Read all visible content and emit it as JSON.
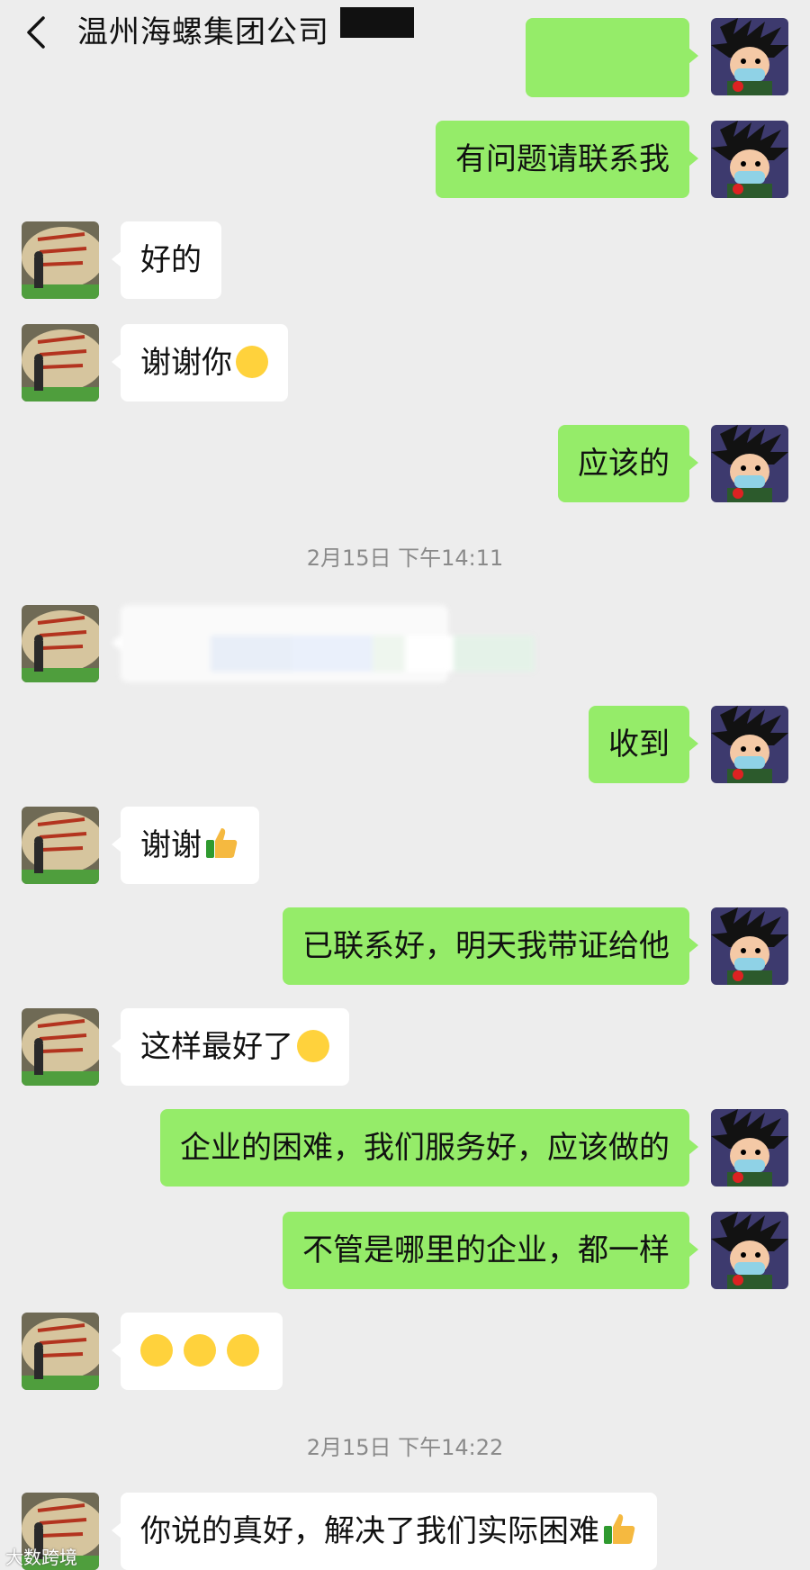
{
  "header": {
    "title": "温州海螺集团公司",
    "back_icon": "chevron-left-icon",
    "more_icon": "more-dots-icon",
    "more_label": "···"
  },
  "colors": {
    "background": "#ededed",
    "mine_bubble": "#95ec69",
    "theirs_bubble": "#ffffff",
    "timestamp": "#8a8a8a"
  },
  "messages": [
    {
      "from": "me",
      "text": "有问题请联系我"
    },
    {
      "from": "them",
      "text": "好的"
    },
    {
      "from": "them",
      "text": "谢谢你",
      "emoji": "smile"
    },
    {
      "from": "me",
      "text": "应该的"
    },
    {
      "type": "time",
      "text": "2月15日 下午14:11"
    },
    {
      "from": "them",
      "text": "",
      "blurred": true
    },
    {
      "from": "me",
      "text": "收到"
    },
    {
      "from": "them",
      "text": "谢谢",
      "emoji": "thumbs-up"
    },
    {
      "from": "me",
      "text": "已联系好，明天我带证给他"
    },
    {
      "from": "them",
      "text": "这样最好了",
      "emoji": "smile"
    },
    {
      "from": "me",
      "text": "企业的困难，我们服务好，应该做的"
    },
    {
      "from": "me",
      "text": "不管是哪里的企业，都一样"
    },
    {
      "from": "them",
      "text": "",
      "emoji": "hug x3"
    },
    {
      "type": "time",
      "text": "2月15日 下午14:22"
    },
    {
      "from": "them",
      "text": "你说的真好，解决了我们实际困难",
      "emoji": "thumbs-up"
    }
  ],
  "watermark": "大数跨境"
}
